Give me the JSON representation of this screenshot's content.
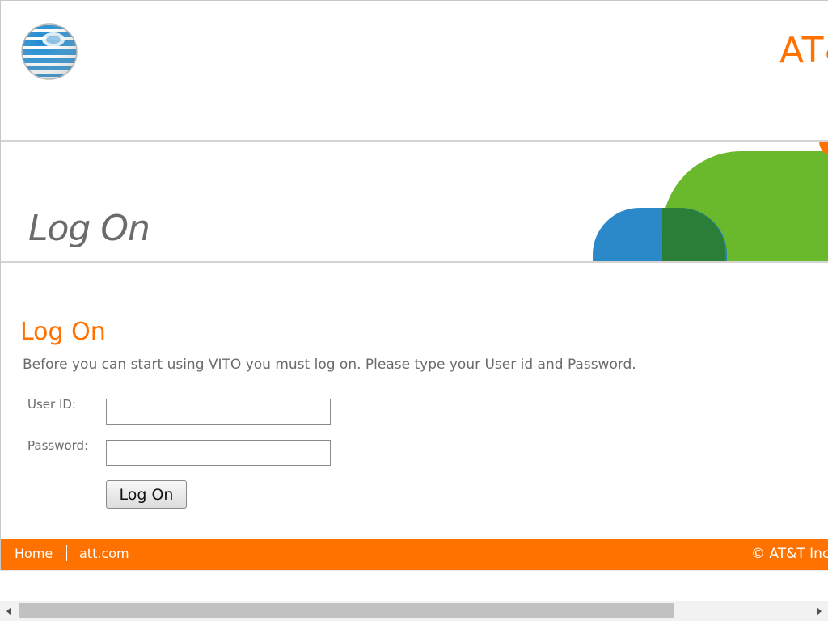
{
  "header": {
    "brand_text": "AT&T",
    "logo_icon": "att-globe-icon"
  },
  "banner": {
    "title": "Log On"
  },
  "main": {
    "heading": "Log On",
    "intro": "Before you can start using VITO you must log on. Please type your User id and Password.",
    "user_id_label": "User ID:",
    "user_id_value": "",
    "password_label": "Password:",
    "password_value": "",
    "submit_label": "Log On"
  },
  "footer": {
    "links": [
      "Home",
      "att.com"
    ],
    "copyright": "© AT&T Inc"
  },
  "colors": {
    "brand_orange": "#ff7200",
    "globe_blue": "#1f8ad0",
    "banner_green": "#6ab82b",
    "banner_blue": "#1a7fc4",
    "text_gray": "#6b6b6b"
  }
}
